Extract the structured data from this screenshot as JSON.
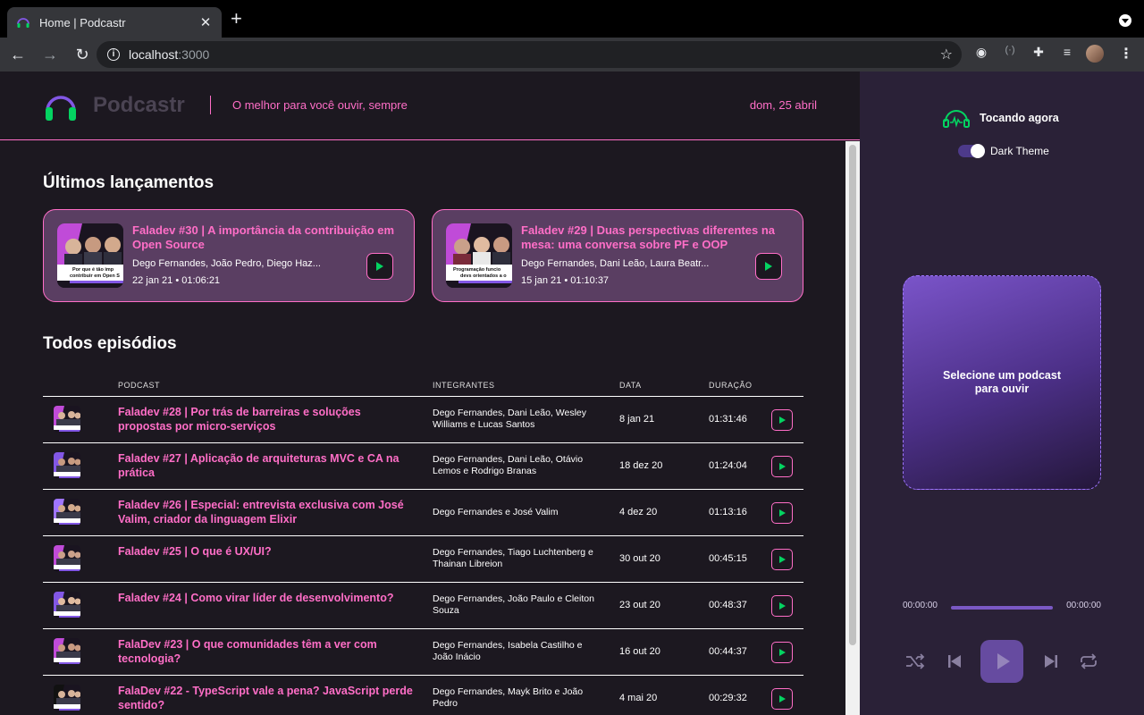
{
  "browser": {
    "tab_title": "Home | Podcastr",
    "url_host": "localhost",
    "url_port": ":3000"
  },
  "header": {
    "brand": "Podcastr",
    "tagline": "O melhor para você ouvir, sempre",
    "date": "dom, 25 abril"
  },
  "latest": {
    "title": "Últimos lançamentos",
    "items": [
      {
        "title": "Faladev #30 | A importância da contribuição em Open Source",
        "members": "Dego Fernandes, João Pedro, Diego Haz...",
        "date": "22 jan 21",
        "duration": "01:06:21",
        "thumb_caption": "Por que é tão imp contribuir em Open S"
      },
      {
        "title": "Faladev #29 | Duas perspectivas diferentes na mesa: uma conversa sobre PF e OOP",
        "members": "Dego Fernandes, Dani Leão, Laura Beatr...",
        "date": "15 jan 21",
        "duration": "01:10:37",
        "thumb_caption": "Programação funcio devs orientados a o"
      }
    ]
  },
  "all": {
    "title": "Todos episódios",
    "columns": [
      "PODCAST",
      "INTEGRANTES",
      "DATA",
      "DURAÇÃO"
    ],
    "rows": [
      {
        "title": "Faladev #28 | Por trás de barreiras e soluções propostas por micro-serviços",
        "members": "Dego Fernandes, Dani Leão, Wesley Williams e Lucas Santos",
        "date": "8 jan 21",
        "duration": "01:31:46"
      },
      {
        "title": "Faladev #27 | Aplicação de arquiteturas MVC e CA na prática",
        "members": "Dego Fernandes, Dani Leão, Otávio Lemos e Rodrigo Branas",
        "date": "18 dez 20",
        "duration": "01:24:04"
      },
      {
        "title": "Faladev #26 | Especial: entrevista exclusiva com José Valim, criador da linguagem Elixir",
        "members": "Dego Fernandes e José Valim",
        "date": "4 dez 20",
        "duration": "01:13:16"
      },
      {
        "title": "Faladev #25 | O que é UX/UI?",
        "members": "Dego Fernandes, Tiago Luchtenberg e Thainan Libreion",
        "date": "30 out 20",
        "duration": "00:45:15"
      },
      {
        "title": "Faladev #24 | Como virar líder de desenvolvimento?",
        "members": "Dego Fernandes, João Paulo e Cleiton Souza",
        "date": "23 out 20",
        "duration": "00:48:37"
      },
      {
        "title": "FalaDev #23 | O que comunidades têm a ver com tecnologia?",
        "members": "Dego Fernandes, Isabela Castilho e João Inácio",
        "date": "16 out 20",
        "duration": "00:44:37"
      },
      {
        "title": "FalaDev #22 - TypeScript vale a pena? JavaScript perde sentido?",
        "members": "Dego Fernandes, Mayk Brito e João Pedro",
        "date": "4 mai 20",
        "duration": "00:29:32"
      }
    ]
  },
  "player": {
    "now_playing": "Tocando agora",
    "theme_label": "Dark Theme",
    "dark_theme_on": true,
    "empty_text": "Selecione um podcast para ouvir",
    "current_time": "00:00:00",
    "total_time": "00:00:00"
  },
  "colors": {
    "accent_pink": "#ff6ec7",
    "accent_green": "#04d361",
    "player_bg": "#2a2137",
    "purple": "#7a59c4"
  },
  "icons": {
    "favicon": "headphones-icon",
    "now_playing": "headphones-waveform-icon",
    "shuffle": "shuffle-icon",
    "previous": "skip-previous-icon",
    "play": "play-icon",
    "next": "skip-next-icon",
    "repeat": "repeat-icon"
  }
}
